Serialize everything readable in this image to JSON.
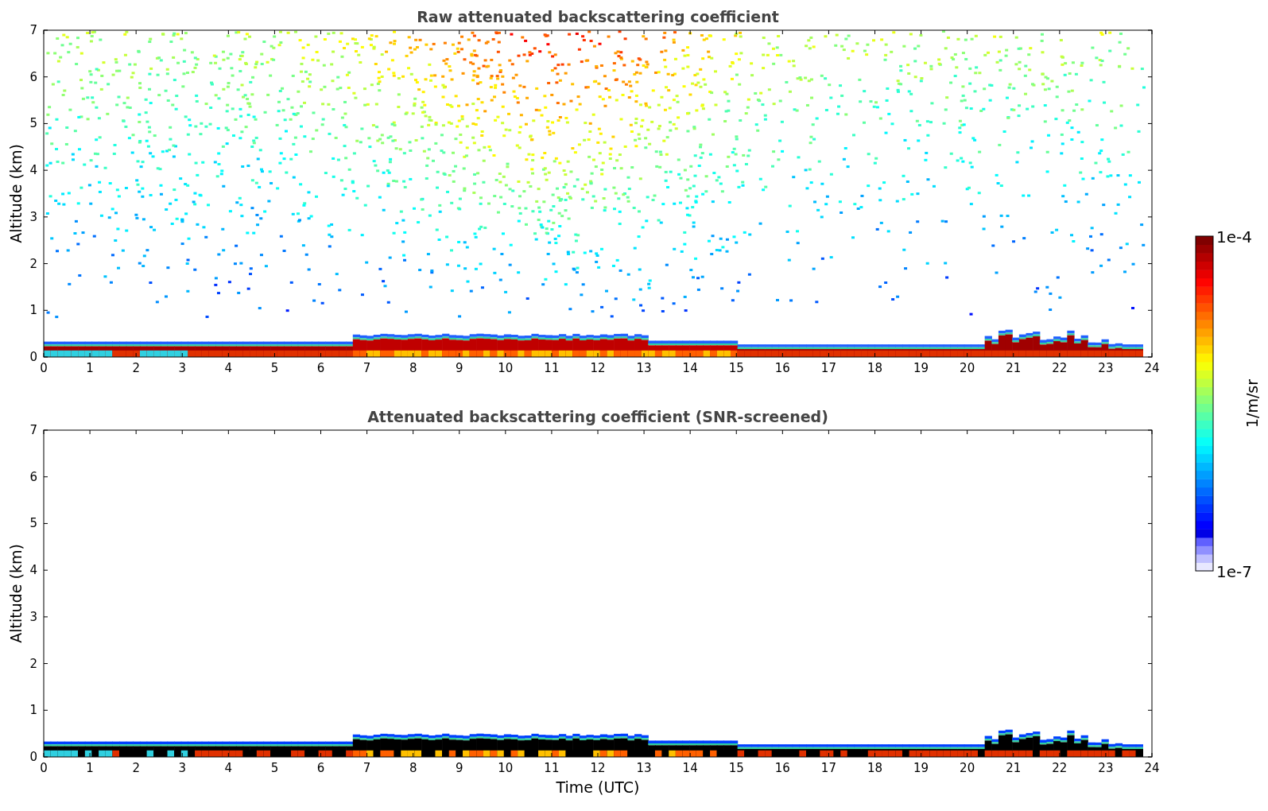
{
  "panels": [
    {
      "kind": "raw",
      "title": "Raw attenuated backscattering coefficient",
      "ylabel": "Altitude (km)",
      "yticks": [
        "7",
        "6",
        "5",
        "4",
        "3",
        "2",
        "1",
        "0"
      ],
      "xticks": [
        "0",
        "1",
        "2",
        "3",
        "4",
        "5",
        "6",
        "7",
        "8",
        "9",
        "10",
        "11",
        "12",
        "13",
        "14",
        "15",
        "16",
        "17",
        "18",
        "19",
        "20",
        "21",
        "22",
        "23",
        "24"
      ]
    },
    {
      "kind": "screened",
      "title": "Attenuated backscattering coefficient (SNR-screened)",
      "ylabel": "Altitude (km)",
      "xlabel": "Time (UTC)",
      "yticks": [
        "7",
        "6",
        "5",
        "4",
        "3",
        "2",
        "1",
        "0"
      ],
      "xticks": [
        "0",
        "1",
        "2",
        "3",
        "4",
        "5",
        "6",
        "7",
        "8",
        "9",
        "10",
        "11",
        "12",
        "13",
        "14",
        "15",
        "16",
        "17",
        "18",
        "19",
        "20",
        "21",
        "22",
        "23",
        "24"
      ]
    }
  ],
  "colorbar": {
    "max_label": "1e-4",
    "min_label": "1e-7",
    "label": "1/m/sr"
  }
}
